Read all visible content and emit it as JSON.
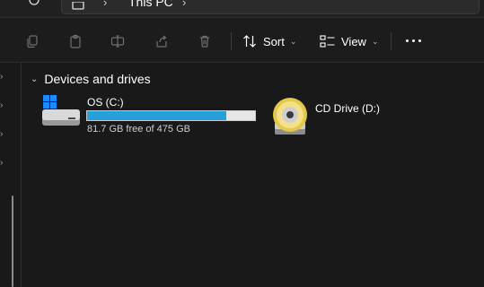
{
  "address_bar": {
    "crumb": "This PC"
  },
  "toolbar": {
    "sort_label": "Sort",
    "view_label": "View"
  },
  "content": {
    "group_title": "Devices and drives",
    "drives": [
      {
        "name": "OS (C:)",
        "free_text": "81.7 GB free of 475 GB",
        "used_fraction": 0.828,
        "bar_color": "#26a0da"
      },
      {
        "name": "CD Drive (D:)"
      }
    ]
  },
  "colors": {
    "background": "#191919",
    "accent": "#26a0da"
  }
}
